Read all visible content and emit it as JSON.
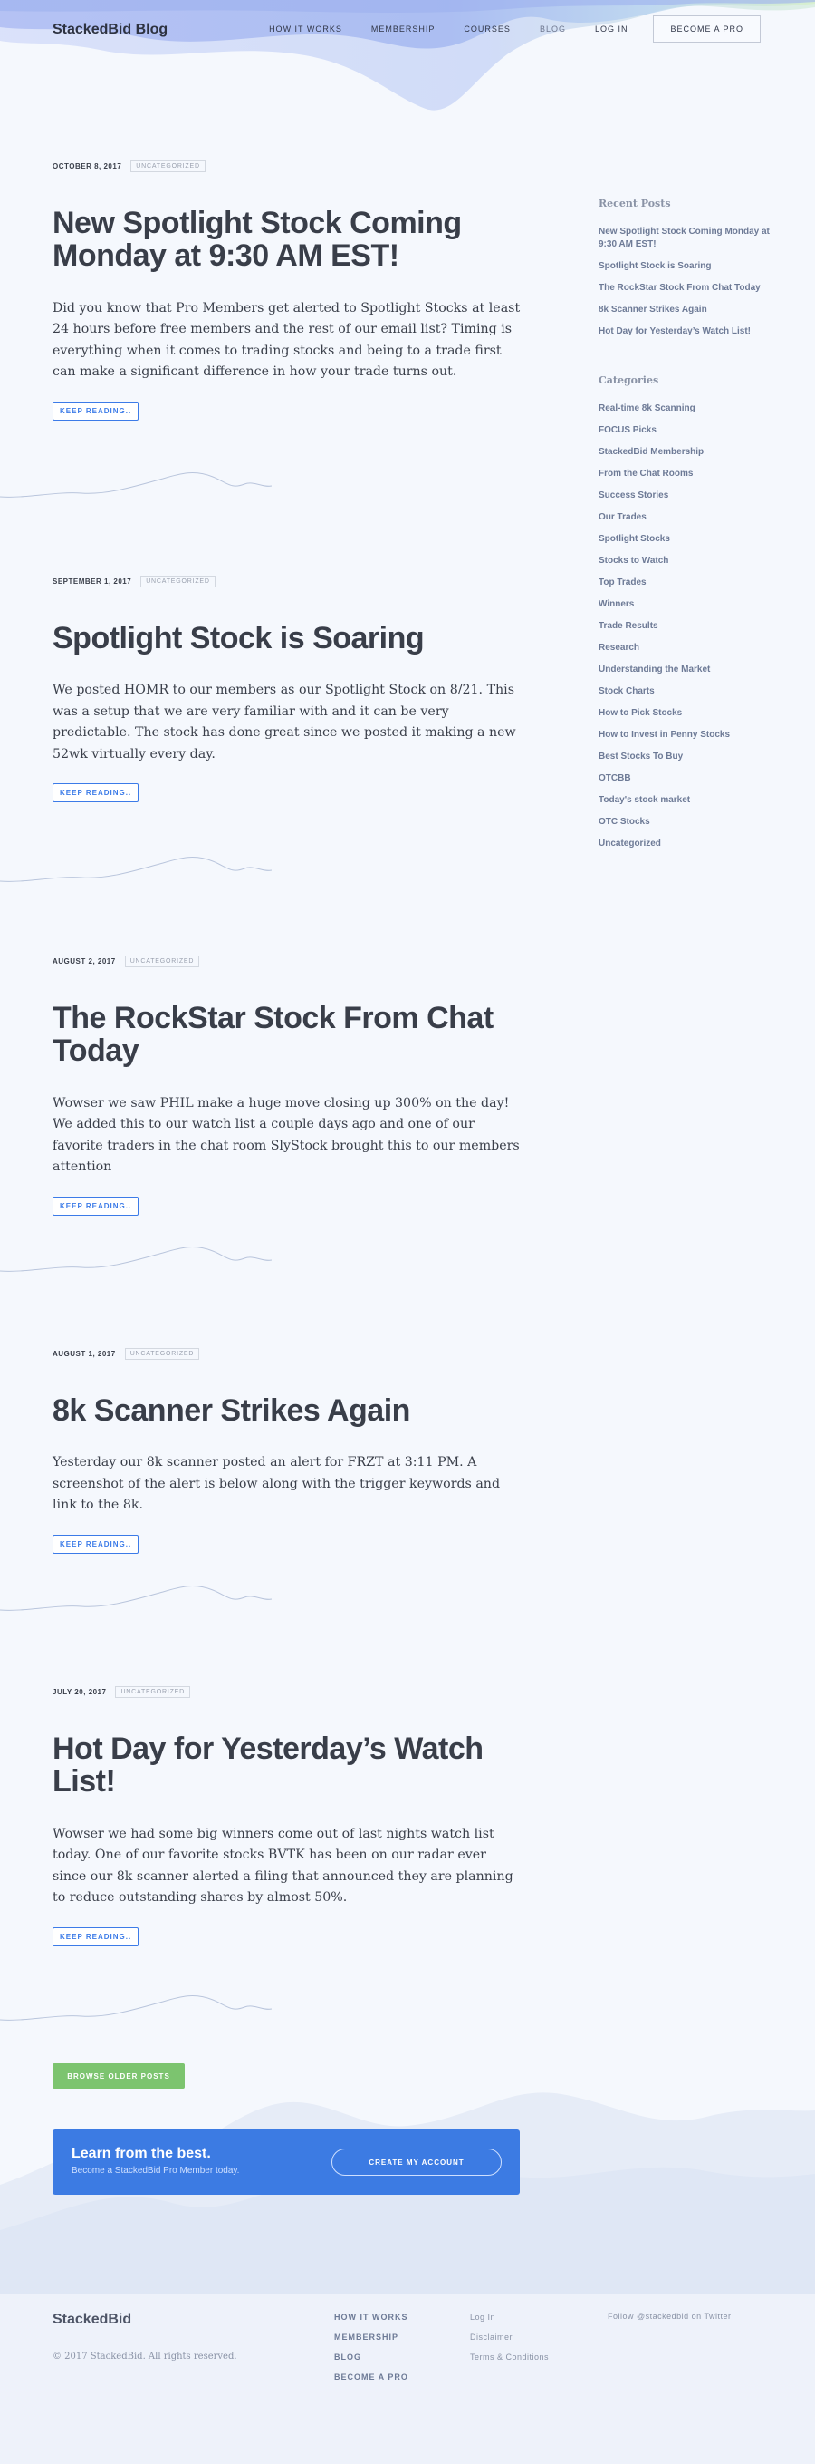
{
  "header": {
    "logo": "StackedBid Blog",
    "nav": [
      "HOW IT WORKS",
      "MEMBERSHIP",
      "COURSES",
      "BLOG",
      "LOG IN"
    ],
    "cta": "BECOME A PRO"
  },
  "posts": [
    {
      "date": "OCTOBER 8, 2017",
      "tag": "UNCATEGORIZED",
      "title": "New Spotlight Stock Coming Monday at 9:30 AM EST!",
      "excerpt": "Did you know that Pro Members get alerted to Spotlight Stocks at least 24 hours before free members and the rest of our email list?  Timing is everything when it comes to trading stocks and being to a trade first can make a significant difference in how your trade turns out.",
      "read_more": "KEEP READING.."
    },
    {
      "date": "SEPTEMBER 1, 2017",
      "tag": "UNCATEGORIZED",
      "title": "Spotlight Stock is Soaring",
      "excerpt": "We posted HOMR to our members as our Spotlight Stock on 8/21.  This was a setup that we are very familiar with and it can be very predictable.  The stock has done great since we posted it making a new 52wk virtually every day.",
      "read_more": "KEEP READING.."
    },
    {
      "date": "AUGUST 2, 2017",
      "tag": "UNCATEGORIZED",
      "title": "The RockStar Stock From Chat Today",
      "excerpt": "Wowser we saw PHIL make a huge move closing up 300% on the day!  We added this to our watch list a couple days ago and one of our favorite traders in the chat room SlyStock brought this to our members attention",
      "read_more": "KEEP READING.."
    },
    {
      "date": "AUGUST 1, 2017",
      "tag": "UNCATEGORIZED",
      "title": "8k Scanner Strikes Again",
      "excerpt": "Yesterday our 8k scanner posted an alert for FRZT at 3:11 PM.  A screenshot of the alert is below along with the trigger keywords and link to the 8k.",
      "read_more": "KEEP READING.."
    },
    {
      "date": "JULY 20, 2017",
      "tag": "UNCATEGORIZED",
      "title": "Hot Day for Yesterday’s Watch List!",
      "excerpt": "Wowser we had some big winners come out of last nights watch list today.  One of our favorite stocks BVTK has been on our radar ever since our 8k scanner alerted a filing that announced they are planning to reduce outstanding shares by almost 50%.",
      "read_more": "KEEP READING.."
    }
  ],
  "sidebar": {
    "recent_heading": "Recent Posts",
    "recent": [
      "New Spotlight Stock Coming Monday at 9:30 AM EST!",
      "Spotlight Stock is Soaring",
      "The RockStar Stock From Chat Today",
      "8k Scanner Strikes Again",
      "Hot Day for Yesterday’s Watch List!"
    ],
    "categories_heading": "Categories",
    "categories": [
      "Real-time 8k Scanning",
      "FOCUS Picks",
      "StackedBid Membership",
      "From the Chat Rooms",
      "Success Stories",
      "Our Trades",
      "Spotlight Stocks",
      "Stocks to Watch",
      "Top Trades",
      "Winners",
      "Trade Results",
      "Research",
      "Understanding the Market",
      "Stock Charts",
      "How to Pick Stocks",
      "How to Invest in Penny Stocks",
      "Best Stocks To Buy",
      "OTCBB",
      "Today's stock market",
      "OTC Stocks",
      "Uncategorized"
    ]
  },
  "older_posts": "BROWSE OLDER POSTS",
  "cta_banner": {
    "title": "Learn from the best.",
    "subtitle": "Become a StackedBid Pro Member today.",
    "button": "CREATE MY ACCOUNT"
  },
  "footer": {
    "logo": "StackedBid",
    "copyright": "© 2017 StackedBid. All rights reserved.",
    "nav": [
      "HOW IT WORKS",
      "MEMBERSHIP",
      "BLOG",
      "BECOME A PRO"
    ],
    "links": [
      "Log In",
      "Disclaimer",
      "Terms & Conditions"
    ],
    "twitter": "Follow @stackedbid on Twitter"
  },
  "colors": {
    "accent": "#3c7be3",
    "green": "#7cc46f",
    "background": "#f5f8fd"
  }
}
